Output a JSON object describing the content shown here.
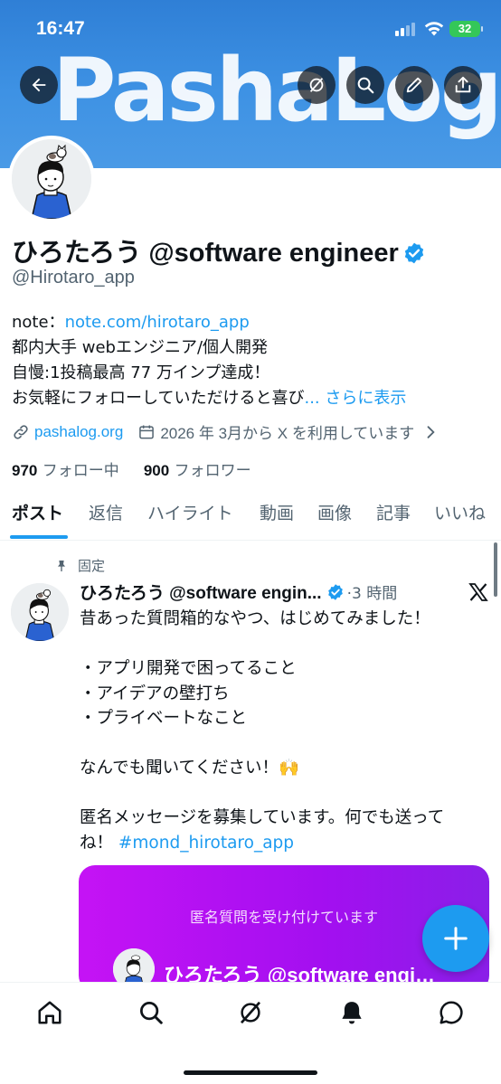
{
  "status_bar": {
    "time": "16:47",
    "battery": "32"
  },
  "banner": {
    "logo_text": "PashaLog"
  },
  "profile": {
    "display_name": "ひろたろう @software engineer",
    "handle": "@Hirotaro_app",
    "bio": {
      "note_label": "note：",
      "note_link": "note.com/hirotaro_app",
      "line2": "都内大手 webエンジニア/個人開発",
      "line3": "自慢:1投稿最高 77 万インプ達成！",
      "line4": "お気軽にフォローしていただけると喜び",
      "more_ellipsis": "... ",
      "more_link": "さらに表示"
    },
    "website": "pashalog.org",
    "joined": "2026 年 3月から X を利用しています",
    "following_count": "970",
    "following_label": "フォロー中",
    "followers_count": "900",
    "followers_label": "フォロワー"
  },
  "tabs": [
    "ポスト",
    "返信",
    "ハイライト",
    "動画",
    "画像",
    "記事",
    "いいね"
  ],
  "post": {
    "pinned_label": "固定",
    "author": "ひろたろう @software engin...",
    "time": "·3 時間",
    "lines": [
      "昔あった質問箱的なやつ、はじめてみました！",
      "",
      "・アプリ開発で困ってること",
      "・アイデアの壁打ち",
      "・プライベートなこと",
      "",
      "なんでも聞いてください！🙌",
      "",
      "匿名メッセージを募集しています。何でも送って"
    ],
    "last_line_prefix": "ね！ ",
    "hashtag": "#mond_hirotaro_app",
    "card_title": "匿名質問を受け付けています",
    "card_name": "ひろたろう @software engi…"
  },
  "colors": {
    "accent": "#1d9bf0",
    "banner": "#3e92e4",
    "card": "#b611f3"
  },
  "icons": {
    "banner": [
      "back-arrow-icon",
      "grok-icon",
      "search-icon",
      "edit-pencil-icon",
      "share-icon"
    ],
    "nav": [
      "home-icon",
      "search-icon",
      "grok-icon",
      "notifications-bell-icon",
      "messages-icon"
    ]
  }
}
